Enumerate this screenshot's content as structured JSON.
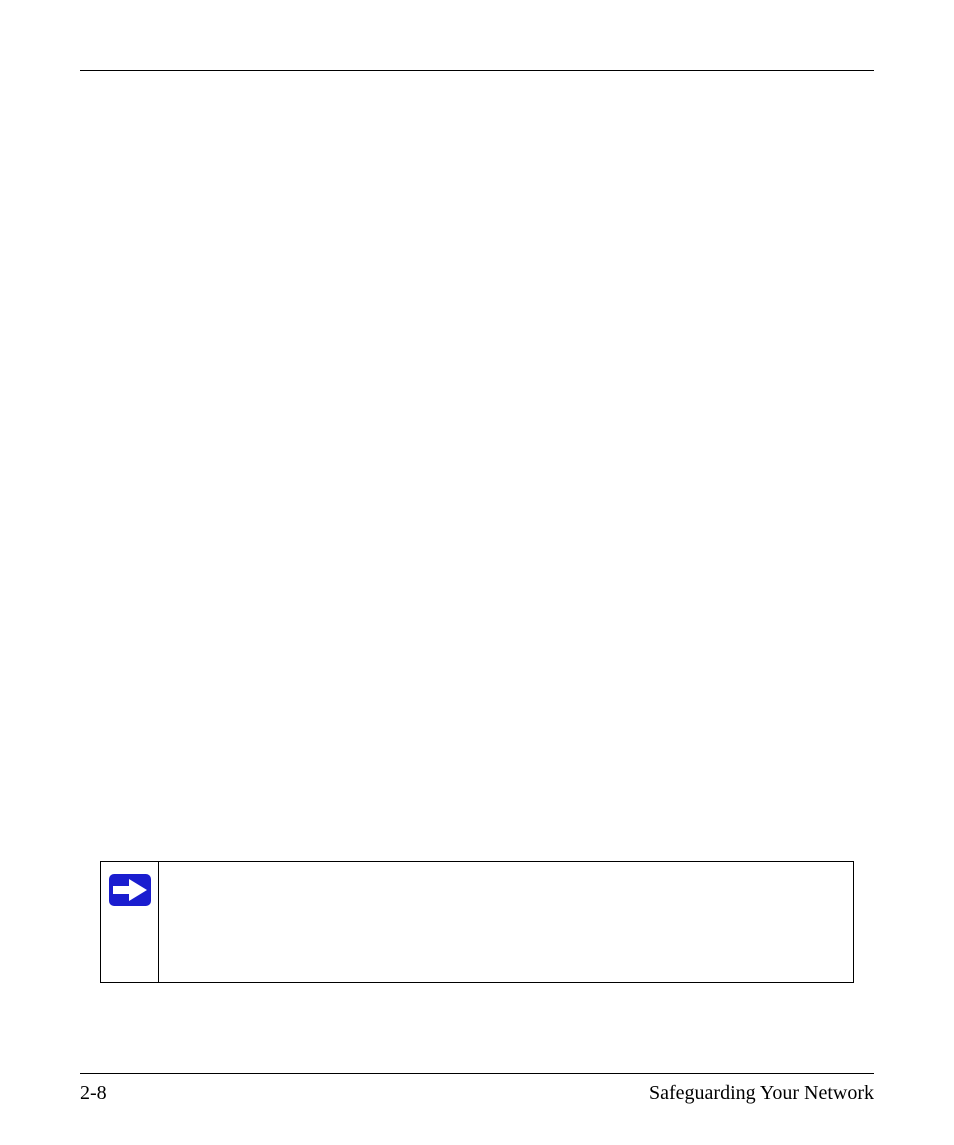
{
  "page": {
    "number_label": "2-8",
    "section_title": "Safeguarding Your Network",
    "notice_text": ""
  },
  "icons": {
    "notice_arrow_fill": "#1a1dcf",
    "notice_arrow_stroke": "#ffffff"
  }
}
